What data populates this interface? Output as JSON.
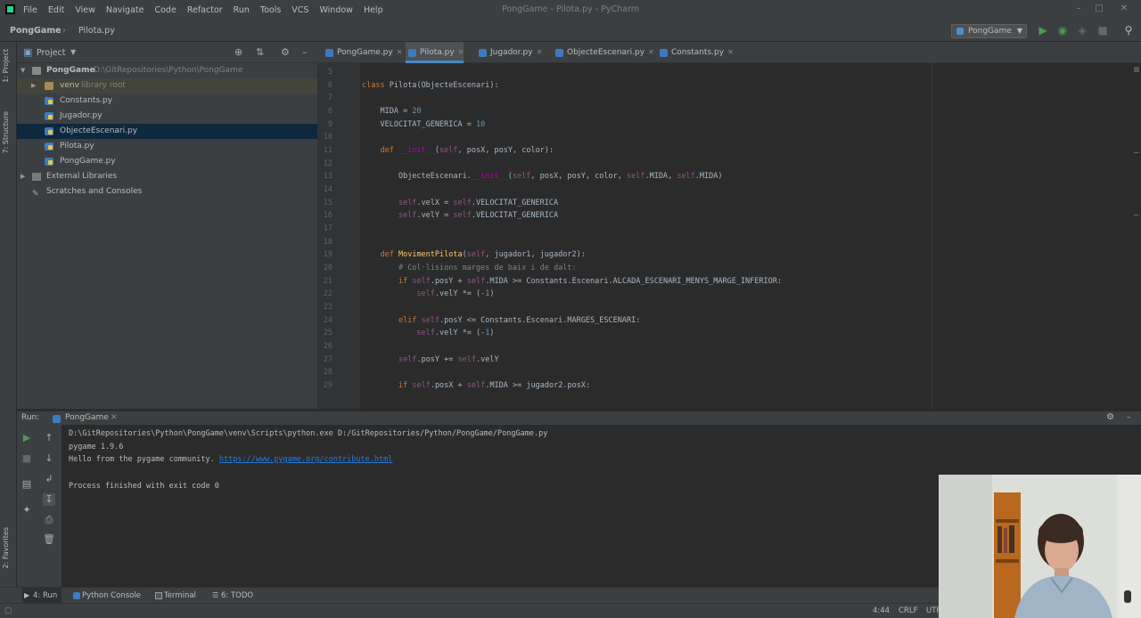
{
  "window": {
    "title": "PongGame - Pilota.py - PyCharm",
    "menu": [
      "File",
      "Edit",
      "View",
      "Navigate",
      "Code",
      "Refactor",
      "Run",
      "Tools",
      "VCS",
      "Window",
      "Help"
    ]
  },
  "navbar": {
    "project": "PongGame",
    "file": "Pilota.py",
    "run_config": "PongGame"
  },
  "left_strip": {
    "project_tab": "1: Project",
    "structure_tab": "7: Structure",
    "favorites_tab": "2: Favorites"
  },
  "project_panel": {
    "title": "Project",
    "tree": [
      {
        "label": "PongGame",
        "sub": "D:\\GitRepositories\\Python\\PongGame",
        "kind": "folder-root",
        "selected": false
      },
      {
        "label": "venv",
        "sub": "library root",
        "kind": "folder",
        "selected": false
      },
      {
        "label": "Constants.py",
        "sub": "",
        "kind": "py",
        "selected": false
      },
      {
        "label": "Jugador.py",
        "sub": "",
        "kind": "py",
        "selected": false
      },
      {
        "label": "ObjecteEscenari.py",
        "sub": "",
        "kind": "py",
        "selected": true
      },
      {
        "label": "Pilota.py",
        "sub": "",
        "kind": "py",
        "selected": false
      },
      {
        "label": "PongGame.py",
        "sub": "",
        "kind": "py",
        "selected": false
      },
      {
        "label": "External Libraries",
        "sub": "",
        "kind": "lib",
        "selected": false
      },
      {
        "label": "Scratches and Consoles",
        "sub": "",
        "kind": "scratch",
        "selected": false
      }
    ]
  },
  "editor_tabs": [
    {
      "label": "PongGame.py",
      "active": false
    },
    {
      "label": "Pilota.py",
      "active": true
    },
    {
      "label": "Jugador.py",
      "active": false
    },
    {
      "label": "ObjecteEscenari.py",
      "active": false
    },
    {
      "label": "Constants.py",
      "active": false
    }
  ],
  "code_lines": [
    {
      "n": "5",
      "code": ""
    },
    {
      "n": "6",
      "code": "class Pilota(ObjecteEscenari):"
    },
    {
      "n": "7",
      "code": ""
    },
    {
      "n": "8",
      "code": "    MIDA = 20"
    },
    {
      "n": "9",
      "code": "    VELOCITAT_GENERICA = 10"
    },
    {
      "n": "10",
      "code": ""
    },
    {
      "n": "11",
      "code": "    def __init__(self, posX, posY, color):"
    },
    {
      "n": "12",
      "code": ""
    },
    {
      "n": "13",
      "code": "        ObjecteEscenari.__init__(self, posX, posY, color, self.MIDA, self.MIDA)"
    },
    {
      "n": "14",
      "code": ""
    },
    {
      "n": "15",
      "code": "        self.velX = self.VELOCITAT_GENERICA"
    },
    {
      "n": "16",
      "code": "        self.velY = self.VELOCITAT_GENERICA"
    },
    {
      "n": "17",
      "code": ""
    },
    {
      "n": "18",
      "code": ""
    },
    {
      "n": "19",
      "code": "    def MovimentPilota(self, jugador1, jugador2):"
    },
    {
      "n": "20",
      "code": "        # Col·lisions marges de baix i de dalt:"
    },
    {
      "n": "21",
      "code": "        if self.posY + self.MIDA >= Constants.Escenari.ALCADA_ESCENARI_MENYS_MARGE_INFERIOR:"
    },
    {
      "n": "22",
      "code": "            self.velY *= (-1)"
    },
    {
      "n": "23",
      "code": ""
    },
    {
      "n": "24",
      "code": "        elif self.posY <= Constants.Escenari.MARGES_ESCENARI:"
    },
    {
      "n": "25",
      "code": "            self.velY *= (-1)"
    },
    {
      "n": "26",
      "code": ""
    },
    {
      "n": "27",
      "code": "        self.posY += self.velY"
    },
    {
      "n": "28",
      "code": ""
    },
    {
      "n": "29",
      "code": "        if self.posX + self.MIDA >= jugador2.posX:"
    }
  ],
  "run_panel": {
    "label": "Run:",
    "tab": "PongGame",
    "output": [
      "D:\\GitRepositories\\Python\\PongGame\\venv\\Scripts\\python.exe D:/GitRepositories/Python/PongGame/PongGame.py",
      "pygame 1.9.6",
      "Hello from the pygame community. ",
      "",
      "Process finished with exit code 0"
    ],
    "link": "https://www.pygame.org/contribute.html"
  },
  "bottom_tabs": [
    {
      "label": "4: Run",
      "active": true
    },
    {
      "label": "Python Console",
      "active": false
    },
    {
      "label": "Terminal",
      "active": false
    },
    {
      "label": "6: TODO",
      "active": false
    }
  ],
  "statusbar": {
    "position": "4:44",
    "line_sep": "CRLF",
    "encoding": "UTF"
  },
  "colors": {
    "accent": "#4a88c7",
    "run_green": "#499c54",
    "selection": "#0d293e"
  }
}
